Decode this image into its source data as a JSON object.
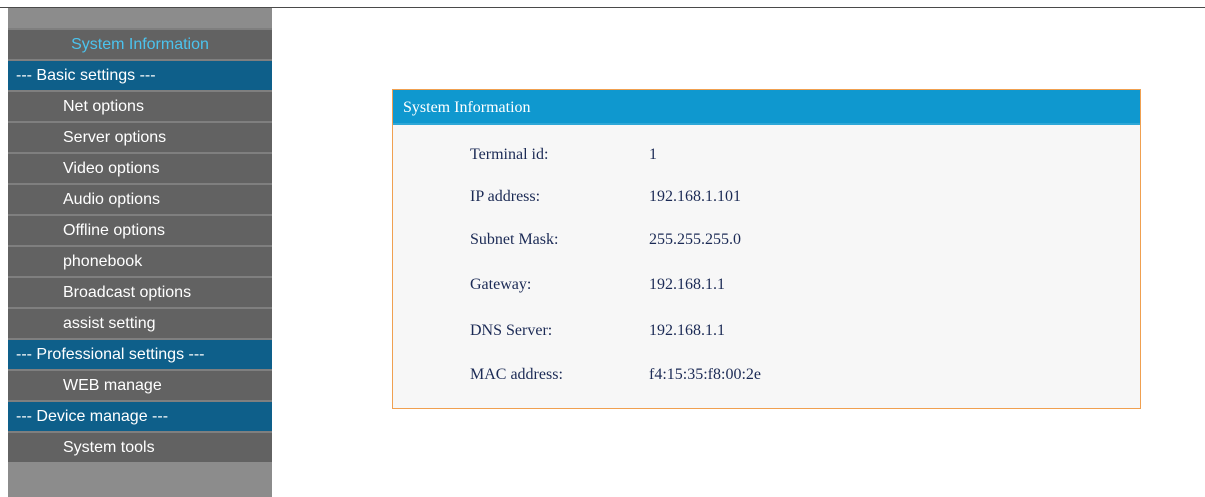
{
  "sidebar": {
    "items": [
      {
        "label": "System Information",
        "type": "active"
      },
      {
        "label": "--- Basic settings ---",
        "type": "section"
      },
      {
        "label": "Net options",
        "type": "link"
      },
      {
        "label": "Server options",
        "type": "link"
      },
      {
        "label": "Video options",
        "type": "link"
      },
      {
        "label": "Audio options",
        "type": "link"
      },
      {
        "label": "Offline options",
        "type": "link"
      },
      {
        "label": "phonebook",
        "type": "link"
      },
      {
        "label": "Broadcast options",
        "type": "link"
      },
      {
        "label": "assist setting",
        "type": "link"
      },
      {
        "label": "--- Professional settings ---",
        "type": "section"
      },
      {
        "label": "WEB manage",
        "type": "link"
      },
      {
        "label": "--- Device manage ---",
        "type": "section"
      },
      {
        "label": "System tools",
        "type": "link"
      }
    ]
  },
  "panel": {
    "title": "System Information",
    "rows": [
      {
        "label": "Terminal id:",
        "value": "1"
      },
      {
        "label": "IP address:",
        "value": "192.168.1.101"
      },
      {
        "label": "Subnet Mask:",
        "value": "255.255.255.0"
      },
      {
        "label": "Gateway:",
        "value": "192.168.1.1"
      },
      {
        "label": "DNS Server:",
        "value": "192.168.1.1"
      },
      {
        "label": "MAC address:",
        "value": "f4:15:35:f8:00:2e"
      }
    ]
  },
  "colors": {
    "sidebar_bg": "#8c8c8c",
    "nav_item_bg": "#626262",
    "section_bg": "#0e5f8a",
    "active_text": "#4bc3ee",
    "panel_header": "#0f98cf",
    "panel_border": "#f0a050",
    "panel_bg": "#f7f7f7"
  }
}
